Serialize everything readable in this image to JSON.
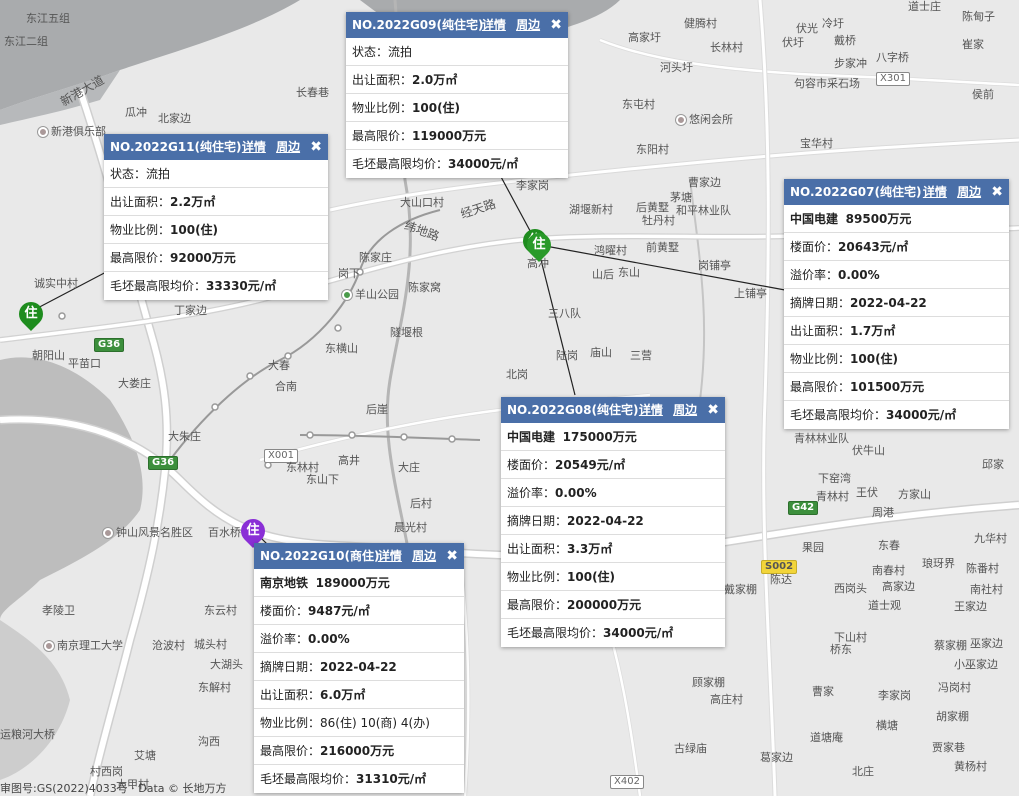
{
  "colors": {
    "header_bg": "#4a6fa8",
    "marker_green": "#1e8c1e",
    "marker_purple": "#8a2fd6",
    "water": "#a9abad",
    "map_bg": "#e9e9e9"
  },
  "places": {
    "dongjiang5": "东江五组",
    "dongjiang2": "东江二组",
    "xingang_road": "新港大道",
    "guachong": "瓜冲",
    "beijiaoyuan": "北家边",
    "xingang_club": "新港俱乐部",
    "changchun": "长春巷",
    "jianteng": "健腾村",
    "fuguang": "伏光",
    "lengyu": "冷圩",
    "daoshi": "道士庄",
    "chendianzi": "陈甸子",
    "gaojia": "高家圩",
    "changlin": "长林村",
    "fukou": "伏圩",
    "daiqiao": "戴桥",
    "bazibang": "八字桥",
    "bujiachong": "步家冲",
    "cuijia": "崔家",
    "hetou": "河头圩",
    "qiao": "句容市采石场",
    "houyu": "侯前",
    "dongtun": "东屯村",
    "youxian": "悠闲会所",
    "baohua": "宝华村",
    "dongyang": "东阳村",
    "lijia": "李家岗",
    "caojia": "曹家边",
    "maotang": "茅塘",
    "huhu": "湖堰新村",
    "houhuang": "后黄墅",
    "mudan": "牡丹村",
    "heping": "和平林业队",
    "dashankou": "大山口村",
    "jingtian": "经天路",
    "weidi": "纬地路",
    "hongyao": "鸿曜村",
    "qianhuang": "前黄墅",
    "gangpu": "岗铺亭",
    "chenjiazhuang": "陈家庄",
    "gaochong": "高冲",
    "shanhou": "山后",
    "dongshan": "东山",
    "shangpu": "上铺亭",
    "chengzhong": "诚实中村",
    "gangxia": "岗下",
    "yangshan": "羊山公园",
    "chenjiawo": "陈家窝",
    "sanbadui": "三八队",
    "zhaoyangshan": "朝阳山",
    "pingmiao": "平苗口",
    "dingjia": "丁家边",
    "suiyanbian": "隧堰根",
    "dongheng": "东横山",
    "dachun": "大春",
    "hexi": "合南",
    "dalou": "大娄庄",
    "suizhi": "陆岗",
    "miaoshan": "庙山",
    "sanying": "三营",
    "beigang": "北岗",
    "houya": "后崖",
    "dazhu": "大朱庄",
    "gaojing": "高井",
    "dongling": "东林村",
    "dongshanxia": "东山下",
    "dazhuang": "大庄",
    "houcun": "后村",
    "chenguang": "晨光村",
    "zhongshan": "钟山风景名胜区",
    "baishui": "百水桥",
    "xiaolinwei": "孝陵卫",
    "dongyun": "东云村",
    "nanjing_univ": "南京理工大学",
    "canglang": "沧波村",
    "chengkou": "城头村",
    "dahuwei": "大湖头",
    "dongjie": "东解村",
    "yunhe": "运粮河大桥",
    "ai": "艾塘",
    "cunxigang": "村西岗",
    "dajia": "大甲村",
    "gouxi": "沟西",
    "qingshi": "青林林业队",
    "xiaguo": "下窑湾",
    "qinglin": "青林村",
    "wangfu": "王伏",
    "fangjia": "方家山",
    "fuzhou": "伏牛山",
    "yujia": "邱家",
    "zhoujia": "周港",
    "jiuhua": "九华村",
    "linpao": "琅玡界",
    "chenzhang": "陈番村",
    "nanchun": "南春村",
    "gaojiabian": "高家边",
    "nanshe": "南社村",
    "dongchun": "东春",
    "guoyuan": "果园",
    "chenda": "陈达",
    "daijiapeng": "戴家棚",
    "xigouta": "西岗头",
    "daoshiguan": "道士观",
    "wangjiabian": "王家边",
    "xiashan": "下山村",
    "qiaodong": "桥东",
    "caijia": "蔡家棚",
    "wujia": "巫家边",
    "xiaowu": "小巫家边",
    "gujiagang": "顾家棚",
    "gaozhuang": "高庄村",
    "caojiafan": "曹家",
    "lijiagang": "李家岗",
    "hengtang": "横塘",
    "fengjia": "冯岗村",
    "hujia": "胡家棚",
    "guli": "古绿庙",
    "daotang": "道塘庵",
    "gejiabian": "葛家边",
    "beizhuang": "北庄",
    "huangyang": "黄杨村",
    "jiajia": "贾家巷",
    "g36a": "G36",
    "g36b": "G36",
    "g42": "G42",
    "s002": "S002",
    "x001": "X001",
    "x301": "X301",
    "x402": "X402"
  },
  "markers": [
    {
      "label": "住"
    },
    {
      "label": "住"
    },
    {
      "label": "住"
    },
    {
      "label": "住"
    }
  ],
  "popups": {
    "g11": {
      "title": "NO.2022G11(纯住宅)",
      "link_detail": "详情",
      "link_around": "周边",
      "close": "✖",
      "rows": [
        {
          "label": "状态：",
          "value": "流拍"
        },
        {
          "label": "出让面积：",
          "value": "2.2万㎡"
        },
        {
          "label": "物业比例：",
          "value": "100(住)"
        },
        {
          "label": "最高限价：",
          "value": "92000万元"
        },
        {
          "label": "毛坯最高限均价：",
          "value": "33330元/㎡"
        }
      ]
    },
    "g09": {
      "title": "NO.2022G09(纯住宅)",
      "link_detail": "详情",
      "link_around": "周边",
      "close": "✖",
      "rows": [
        {
          "label": "状态：",
          "value": "流拍"
        },
        {
          "label": "出让面积：",
          "value": "2.0万㎡"
        },
        {
          "label": "物业比例：",
          "value": "100(住)"
        },
        {
          "label": "最高限价：",
          "value": "119000万元"
        },
        {
          "label": "毛坯最高限均价：",
          "value": "34000元/㎡"
        }
      ]
    },
    "g07": {
      "title": "NO.2022G07(纯住宅)",
      "link_detail": "详情",
      "link_around": "周边",
      "close": "✖",
      "winner": "中国电建",
      "winner_price": "89500万元",
      "rows": [
        {
          "label": "楼面价：",
          "value": "20643元/㎡"
        },
        {
          "label": "溢价率：",
          "value": "0.00%"
        },
        {
          "label": "摘牌日期：",
          "value": "2022-04-22"
        },
        {
          "label": "出让面积：",
          "value": "1.7万㎡"
        },
        {
          "label": "物业比例：",
          "value": "100(住)"
        },
        {
          "label": "最高限价：",
          "value": "101500万元"
        },
        {
          "label": "毛坯最高限均价：",
          "value": "34000元/㎡"
        }
      ]
    },
    "g08": {
      "title": "NO.2022G08(纯住宅)",
      "link_detail": "详情",
      "link_around": "周边",
      "close": "✖",
      "winner": "中国电建",
      "winner_price": "175000万元",
      "rows": [
        {
          "label": "楼面价：",
          "value": "20549元/㎡"
        },
        {
          "label": "溢价率：",
          "value": "0.00%"
        },
        {
          "label": "摘牌日期：",
          "value": "2022-04-22"
        },
        {
          "label": "出让面积：",
          "value": "3.3万㎡"
        },
        {
          "label": "物业比例：",
          "value": "100(住)"
        },
        {
          "label": "最高限价：",
          "value": "200000万元"
        },
        {
          "label": "毛坯最高限均价：",
          "value": "34000元/㎡"
        }
      ]
    },
    "g10": {
      "title": "NO.2022G10(商住)",
      "link_detail": "详情",
      "link_around": "周边",
      "close": "✖",
      "winner": "南京地铁",
      "winner_price": "189000万元",
      "rows": [
        {
          "label": "楼面价：",
          "value": "9487元/㎡"
        },
        {
          "label": "溢价率：",
          "value": "0.00%"
        },
        {
          "label": "摘牌日期：",
          "value": "2022-04-22"
        },
        {
          "label": "出让面积：",
          "value": "6.0万㎡"
        },
        {
          "label": "物业比例：",
          "value": "86(住) 10(商) 4(办)"
        },
        {
          "label": "最高限价：",
          "value": "216000万元"
        },
        {
          "label": "毛坯最高限均价：",
          "value": "31310元/㎡"
        }
      ]
    }
  },
  "copyright": "审图号:GS(2022)4033号 · Data © 长地万方"
}
